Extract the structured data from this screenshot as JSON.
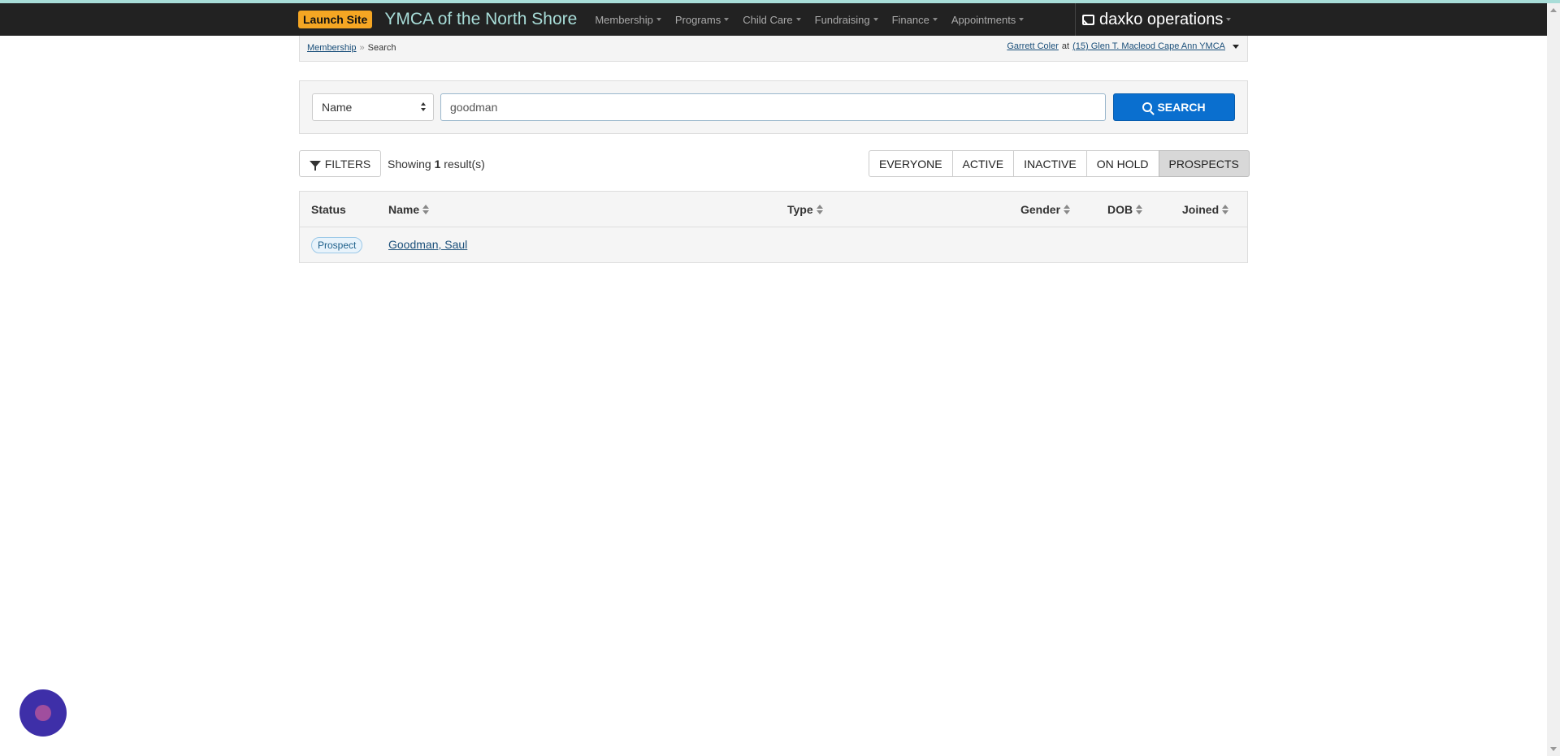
{
  "navbar": {
    "launch_label": "Launch Site",
    "org_name": "YMCA of the North Shore",
    "menu": [
      {
        "label": "Membership"
      },
      {
        "label": "Programs"
      },
      {
        "label": "Child Care"
      },
      {
        "label": "Fundraising"
      },
      {
        "label": "Finance"
      },
      {
        "label": "Appointments"
      }
    ],
    "brand": "daxko operations",
    "brand_icon": "envelope-icon",
    "accent_color": "#a8ddd8",
    "launch_color": "#f5a623"
  },
  "breadcrumb": {
    "parent": "Membership",
    "separator": "»",
    "current": "Search"
  },
  "user": {
    "name": "Garrett Coler",
    "at": "at",
    "location": "(15) Glen T. Macleod Cape Ann YMCA"
  },
  "search": {
    "field_select": "Name",
    "query": "goodman",
    "button_label": "SEARCH",
    "button_color": "#0a6fcf"
  },
  "results": {
    "filters_label": "FILTERS",
    "showing_prefix": "Showing",
    "count": "1",
    "showing_suffix": "result(s)",
    "segments": [
      {
        "label": "EVERYONE",
        "active": false
      },
      {
        "label": "ACTIVE",
        "active": false
      },
      {
        "label": "INACTIVE",
        "active": false
      },
      {
        "label": "ON HOLD",
        "active": false
      },
      {
        "label": "PROSPECTS",
        "active": true
      }
    ]
  },
  "table": {
    "columns": {
      "status": "Status",
      "name": "Name",
      "type": "Type",
      "gender": "Gender",
      "dob": "DOB",
      "joined": "Joined"
    },
    "rows": [
      {
        "status": "Prospect",
        "name": "Goodman, Saul",
        "type": "",
        "gender": "",
        "dob": "",
        "joined": ""
      }
    ]
  },
  "chat_widget": {
    "icon": "chat-bubble-icon",
    "color": "#3e2fa8"
  }
}
